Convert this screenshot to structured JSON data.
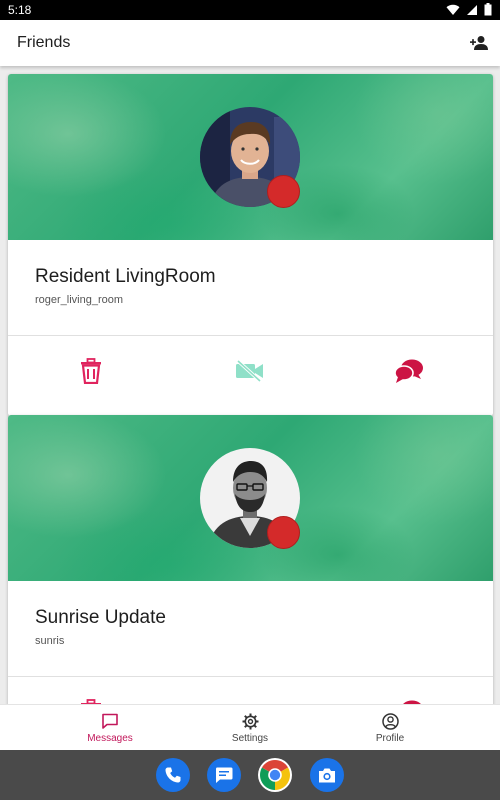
{
  "status_bar": {
    "time": "5:18"
  },
  "app_bar": {
    "title": "Friends"
  },
  "friends": [
    {
      "name": "Resident LivingRoom",
      "username": "roger_living_room"
    },
    {
      "name": "Sunrise Update",
      "username": "sunris"
    }
  ],
  "bottom_nav": [
    {
      "label": "Messages",
      "icon": "chat-bubble-outline-icon",
      "active": true
    },
    {
      "label": "Settings",
      "icon": "gear-icon",
      "active": false
    },
    {
      "label": "Profile",
      "icon": "account-circle-icon",
      "active": false
    }
  ],
  "dock": [
    "phone-app-icon",
    "messages-app-icon",
    "chrome-app-icon",
    "camera-app-icon"
  ],
  "colors": {
    "accent": "#c2185b",
    "delete_red": "#e0245e",
    "video_teal": "#8fe0c8",
    "chat_red": "#cc1444",
    "status_dot": "#d42a2a",
    "banner_green": "#3cb07a"
  }
}
